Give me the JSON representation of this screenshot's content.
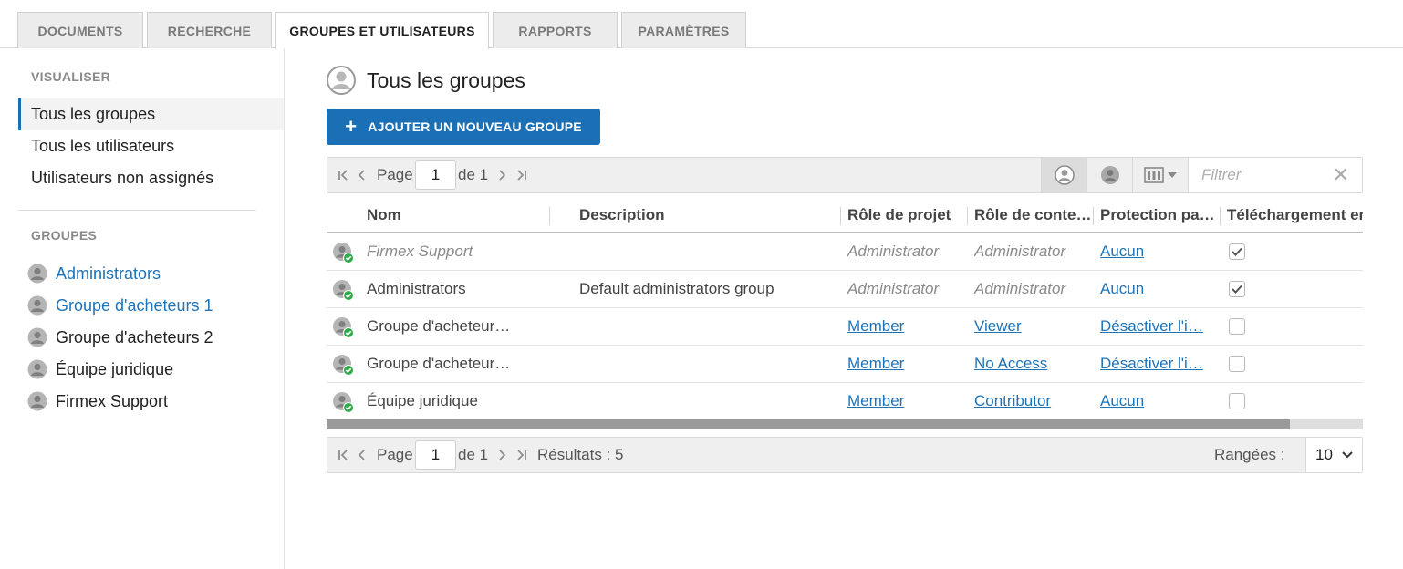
{
  "tabs": [
    {
      "label": "DOCUMENTS",
      "active": false
    },
    {
      "label": "RECHERCHE",
      "active": false
    },
    {
      "label": "GROUPES ET UTILISATEURS",
      "active": true
    },
    {
      "label": "RAPPORTS",
      "active": false
    },
    {
      "label": "PARAMÈTRES",
      "active": false
    }
  ],
  "sidebar": {
    "view_heading": "VISUALISER",
    "view_items": [
      "Tous les groupes",
      "Tous les utilisateurs",
      "Utilisateurs non assignés"
    ],
    "groups_heading": "GROUPES",
    "groups": [
      "Administrators",
      "Groupe d'acheteurs 1",
      "Groupe d'acheteurs 2",
      "Équipe juridique",
      "Firmex Support"
    ]
  },
  "main": {
    "title": "Tous les groupes",
    "add_button": "AJOUTER UN NOUVEAU GROUPE"
  },
  "pager_top": {
    "page_label": "Page",
    "page_value": "1",
    "of_label": "de 1",
    "filter_placeholder": "Filtrer"
  },
  "table": {
    "headers": [
      "Nom",
      "Description",
      "Rôle de projet",
      "Rôle de conte…",
      "Protection pa…",
      "Téléchargement en"
    ],
    "rows": [
      {
        "name": "Firmex Support",
        "description": "",
        "project_role": "Administrator",
        "content_role": "Administrator",
        "protection": "Aucun",
        "download": true,
        "system": true
      },
      {
        "name": "Administrators",
        "description": "Default administrators group",
        "project_role": "Administrator",
        "content_role": "Administrator",
        "protection": "Aucun",
        "download": true,
        "system": false
      },
      {
        "name": "Groupe d'acheteur…",
        "description": "",
        "project_role": "Member",
        "content_role": "Viewer",
        "protection": "Désactiver l'i…",
        "download": false,
        "system": false
      },
      {
        "name": "Groupe d'acheteur…",
        "description": "",
        "project_role": "Member",
        "content_role": "No Access",
        "protection": "Désactiver l'i…",
        "download": false,
        "system": false
      },
      {
        "name": "Équipe juridique",
        "description": "",
        "project_role": "Member",
        "content_role": "Contributor",
        "protection": "Aucun",
        "download": false,
        "system": false
      }
    ]
  },
  "pager_bottom": {
    "page_label": "Page",
    "page_value": "1",
    "of_label": "de 1",
    "results": "Résultats : 5",
    "rows_label": "Rangées :",
    "rows_value": "10"
  },
  "colors": {
    "accent": "#1a6fb5",
    "link": "#1f73b7",
    "check_green": "#2eaa4a"
  }
}
